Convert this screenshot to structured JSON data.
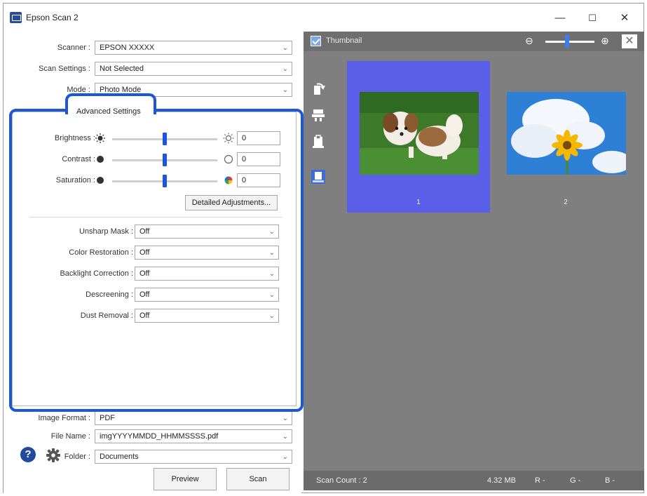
{
  "window": {
    "title": "Epson Scan 2"
  },
  "window_controls": {
    "minimize": "—",
    "maximize": "☐",
    "close": "✕"
  },
  "main_settings": {
    "scanner_label": "Scanner :",
    "scanner_value": "EPSON XXXXX",
    "scan_settings_label": "Scan Settings :",
    "scan_settings_value": "Not Selected",
    "mode_label": "Mode :",
    "mode_value": "Photo Mode"
  },
  "advanced": {
    "tab_label": "Advanced Settings",
    "brightness": {
      "label": "Brightness :",
      "value": "0",
      "level": 0.5
    },
    "contrast": {
      "label": "Contrast :",
      "value": "0",
      "level": 0.5
    },
    "saturation": {
      "label": "Saturation :",
      "value": "0",
      "level": 0.5
    },
    "detailed_button": "Detailed Adjustments...",
    "options": [
      {
        "label": "Unsharp Mask :",
        "value": "Off"
      },
      {
        "label": "Color Restoration :",
        "value": "Off"
      },
      {
        "label": "Backlight Correction :",
        "value": "Off"
      },
      {
        "label": "Descreening :",
        "value": "Off"
      },
      {
        "label": "Dust Removal :",
        "value": "Off"
      }
    ]
  },
  "output": {
    "image_format_label": "Image Format :",
    "image_format_value": "PDF",
    "file_name_label": "File Name :",
    "file_name_value": "imgYYYYMMDD_HHMMSSSS.pdf",
    "folder_label": "Folder :",
    "folder_value": "Documents"
  },
  "buttons": {
    "preview": "Preview",
    "scan": "Scan",
    "help": "?"
  },
  "preview_panel": {
    "thumbnail_label": "Thumbnail",
    "zoom_out": "⊖",
    "zoom_in": "⊕",
    "close": "✕",
    "thumbnails": [
      {
        "number": "1",
        "selected": true
      },
      {
        "number": "2",
        "selected": false
      }
    ]
  },
  "status": {
    "scan_count": "Scan Count : 2",
    "size": "4.32 MB",
    "r": "R  -",
    "g": "G  -",
    "b": "B  -"
  },
  "colors": {
    "highlight": "#1d56d8",
    "slider_thumb": "#1d56d8",
    "selected_thumb": "#5a5ee8"
  }
}
